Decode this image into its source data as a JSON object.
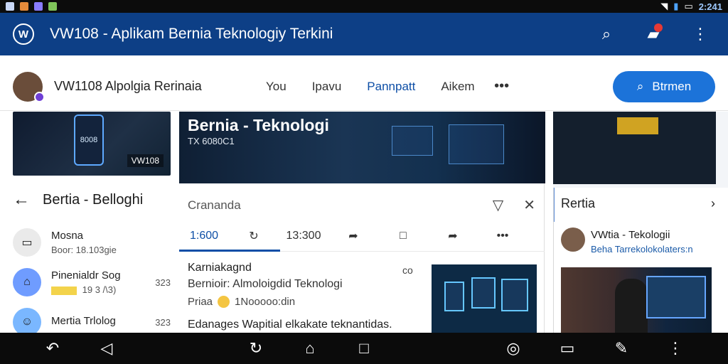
{
  "status_bar": {
    "time": "2:241"
  },
  "app_bar": {
    "title": "VW108 - Aplikam Bernia Teknologiy Terkini",
    "logo_text": "W"
  },
  "profile": {
    "text": "VW1108  Alpolgia Rerinaia"
  },
  "tabs": {
    "items": [
      {
        "label": "You"
      },
      {
        "label": "Ipavu"
      },
      {
        "label": "Pannpatt"
      },
      {
        "label": "Aikem"
      }
    ]
  },
  "search_button": {
    "label": "Btrmen"
  },
  "left": {
    "thumb_label": "VW108",
    "thumb_phone": "8008",
    "header": "Bertia - Belloghi",
    "items": [
      {
        "title": "Mosna",
        "meta": "Boor: 18.103gie",
        "side": ""
      },
      {
        "title": "Pinenialdr Sog",
        "meta": "19 3 /\\3)",
        "side": "323"
      },
      {
        "title": "Mertia Trlolog",
        "meta": "",
        "side": "323"
      }
    ]
  },
  "hero": {
    "title": "Bernia - Teknologi",
    "subtitle": "TX 6080C1"
  },
  "article": {
    "top_label": "Crananda",
    "toolbar": {
      "time_1": "1:600",
      "time_2": "13:300"
    },
    "title": "Karniakagnd",
    "line_1": "Bernioir: Almoloigdid Teknologi",
    "line_2_left": "Priaa",
    "line_2_right": "1Nooooo:din",
    "caption": "Edanages Wapitial elkakate teknantidas.",
    "side_char": "co"
  },
  "right": {
    "head": "Rertia",
    "card_title": "VWtia - Tekologii",
    "card_subtitle": "Beha Tarrekolokolaters:n"
  },
  "colors": {
    "app_blue": "#0d3f86",
    "accent_blue": "#1c73d9",
    "nav_black": "#0b0b0b"
  }
}
